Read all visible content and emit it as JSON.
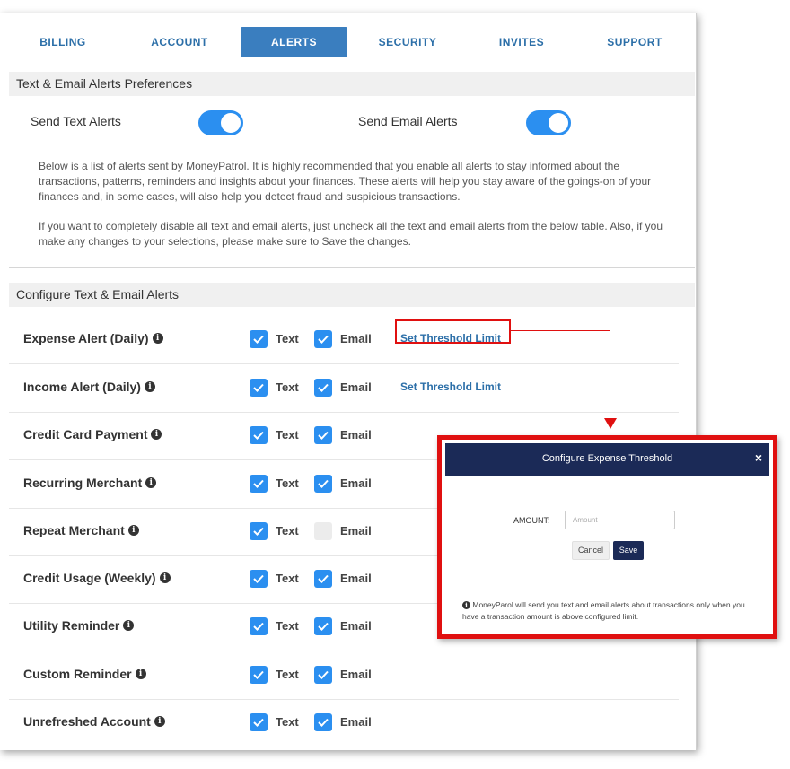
{
  "tabs": [
    {
      "label": "BILLING"
    },
    {
      "label": "ACCOUNT"
    },
    {
      "label": "ALERTS"
    },
    {
      "label": "SECURITY"
    },
    {
      "label": "INVITES"
    },
    {
      "label": "SUPPORT"
    }
  ],
  "active_tab": "ALERTS",
  "preferences": {
    "title": "Text & Email Alerts Preferences",
    "send_text_label": "Send Text Alerts",
    "send_email_label": "Send Email Alerts",
    "send_text_on": true,
    "send_email_on": true,
    "description_1": "Below is a list of alerts sent by MoneyPatrol. It is highly recommended that you enable all alerts to stay informed about the transactions, patterns, reminders and insights about your finances. These alerts will help you stay aware of the goings-on of your finances and, in some cases, will also help you detect fraud and suspicious transactions.",
    "description_2": "If you want to completely disable all text and email alerts, just uncheck all the text and email alerts from the below table. Also, if you make any changes to your selections, please make sure to Save the changes."
  },
  "configure": {
    "title": "Configure Text & Email Alerts",
    "text_label": "Text",
    "email_label": "Email",
    "threshold_label": "Set Threshold Limit",
    "rows": [
      {
        "label": "Expense Alert (Daily)",
        "text": true,
        "email": true,
        "threshold": true
      },
      {
        "label": "Income Alert (Daily)",
        "text": true,
        "email": true,
        "threshold": true
      },
      {
        "label": "Credit Card Payment",
        "text": true,
        "email": true,
        "threshold": false
      },
      {
        "label": "Recurring Merchant",
        "text": true,
        "email": true,
        "threshold": false
      },
      {
        "label": "Repeat Merchant",
        "text": true,
        "email": false,
        "threshold": false
      },
      {
        "label": "Credit Usage (Weekly)",
        "text": true,
        "email": true,
        "threshold": false
      },
      {
        "label": "Utility Reminder",
        "text": true,
        "email": true,
        "threshold": false
      },
      {
        "label": "Custom Reminder",
        "text": true,
        "email": true,
        "threshold": false
      },
      {
        "label": "Unrefreshed Account",
        "text": true,
        "email": true,
        "threshold": false
      }
    ]
  },
  "modal": {
    "title": "Configure Expense Threshold",
    "close_glyph": "×",
    "amount_label": "AMOUNT:",
    "amount_placeholder": "Amount",
    "cancel_label": "Cancel",
    "save_label": "Save",
    "note": "MoneyParol will send you text and email alerts about transactions only when you have a transaction amount is above configured limit."
  },
  "colors": {
    "accent": "#2b8ff0",
    "tab_active": "#3a7ebf",
    "modal_header": "#1b2a57",
    "highlight": "#e01010"
  }
}
